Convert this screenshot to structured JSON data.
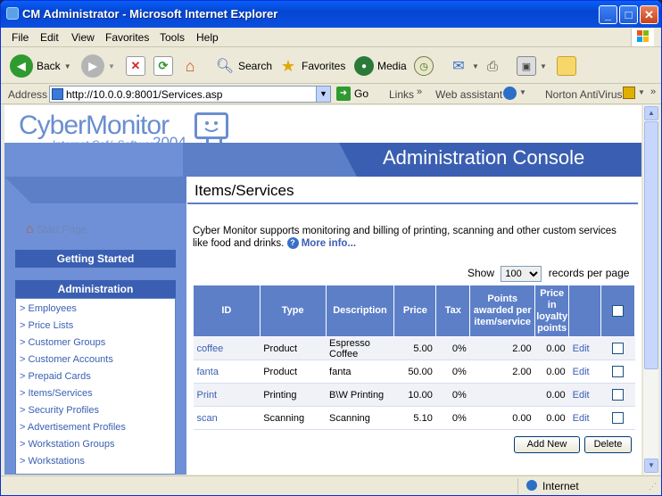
{
  "window": {
    "title": "CM Administrator - Microsoft Internet Explorer",
    "minimize": "_",
    "maximize": "□",
    "close": "✕"
  },
  "menu": [
    "File",
    "Edit",
    "View",
    "Favorites",
    "Tools",
    "Help"
  ],
  "toolbar": {
    "back": "Back",
    "search": "Search",
    "favorites": "Favorites",
    "media": "Media"
  },
  "address": {
    "label": "Address",
    "url": "http://10.0.0.9:8001/Services.asp",
    "go": "Go",
    "links": "Links",
    "web_assistant": "Web assistant",
    "norton": "Norton AntiVirus"
  },
  "brand": {
    "logo": "CyberMonitor",
    "tagline": "Internet Café Software",
    "year": "2004",
    "console": "Administration Console"
  },
  "sidebar": {
    "start_page": "Start Page",
    "getting_started": "Getting Started",
    "administration": "Administration",
    "items": [
      "> Employees",
      "> Price Lists",
      "> Customer Groups",
      "> Customer Accounts",
      "> Prepaid Cards",
      "> Items/Services",
      "> Security Profiles",
      "> Advertisement Profiles",
      "> Workstation Groups",
      "> Workstations"
    ]
  },
  "main": {
    "title": "Items/Services",
    "intro": "Cyber Monitor supports monitoring and billing of printing, scanning and other custom services like food and drinks.",
    "more_info": "More info...",
    "show_label": "Show",
    "records_value": "100",
    "records_suffix": "records per page",
    "headers": [
      "ID",
      "Type",
      "Description",
      "Price",
      "Tax",
      "Points awarded per item/service",
      "Price in loyalty points",
      "",
      ""
    ],
    "rows": [
      {
        "id": "coffee",
        "type": "Product",
        "description": "Espresso Coffee",
        "price": "5.00",
        "tax": "0%",
        "points": "2.00",
        "loyalty": "0.00",
        "edit": "Edit"
      },
      {
        "id": "fanta",
        "type": "Product",
        "description": "fanta",
        "price": "50.00",
        "tax": "0%",
        "points": "2.00",
        "loyalty": "0.00",
        "edit": "Edit"
      },
      {
        "id": "Print",
        "type": "Printing",
        "description": "B\\W Printing",
        "price": "10.00",
        "tax": "0%",
        "points": "",
        "loyalty": "0.00",
        "edit": "Edit"
      },
      {
        "id": "scan",
        "type": "Scanning",
        "description": "Scanning",
        "price": "5.10",
        "tax": "0%",
        "points": "0.00",
        "loyalty": "0.00",
        "edit": "Edit"
      }
    ],
    "add_new": "Add New",
    "delete": "Delete"
  },
  "status": {
    "zone": "Internet"
  },
  "colors": {
    "accent": "#5c7fc8",
    "dark_accent": "#3a5fb2",
    "titlebar": "#0a5ffa"
  }
}
